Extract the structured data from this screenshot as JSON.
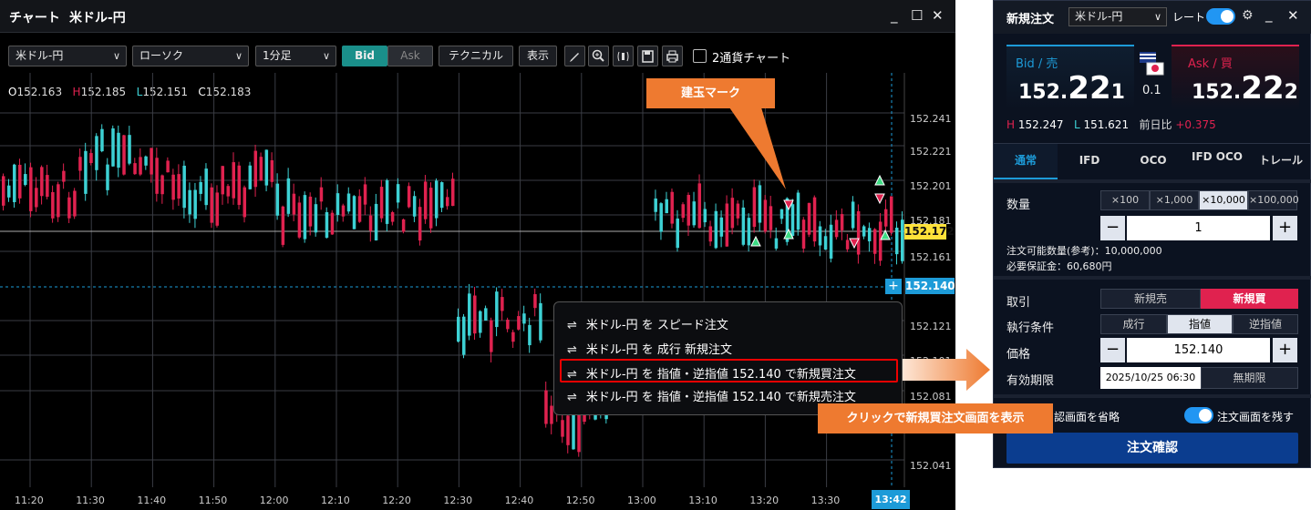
{
  "chart_window": {
    "title": "チャート",
    "symbol": "米ドル-円",
    "controls": {
      "min": "_",
      "max": "☐",
      "close": "✕"
    }
  },
  "toolbar": {
    "symbol_select": "米ドル-円",
    "chart_type_select": "ローソク",
    "interval_select": "1分足",
    "bid_label": "Bid",
    "ask_label": "Ask",
    "technical_label": "テクニカル",
    "display_label": "表示",
    "two_currency_label": "2通貨チャート",
    "icons": [
      "pencil-icon",
      "zoom-icon",
      "sound-icon",
      "save-icon",
      "print-icon"
    ]
  },
  "ohlc": {
    "o_key": "O",
    "o": "152.163",
    "h_key": "H",
    "h": "152.185",
    "l_key": "L",
    "l": "152.151",
    "c_key": "C",
    "c": "152.183"
  },
  "price_axis": [
    "152.241",
    "152.221",
    "152.201",
    "152.181",
    "152.161",
    "152.121",
    "152.101",
    "152.081",
    "152.041"
  ],
  "time_axis": [
    "11:20",
    "11:30",
    "11:40",
    "11:50",
    "12:00",
    "12:10",
    "12:20",
    "12:30",
    "12:40",
    "12:50",
    "13:00",
    "13:10",
    "13:20",
    "13:30"
  ],
  "current_price": "152.172",
  "bid_line_price": "152.140",
  "bid_line_plus": "+",
  "time_badge": "13:42",
  "context_menu": {
    "items": [
      "米ドル-円 を スピード注文",
      "米ドル-円 を 成行 新規注文",
      "米ドル-円 を 指値・逆指値 152.140 で新規買注文",
      "米ドル-円 を 指値・逆指値 152.140 で新規売注文"
    ],
    "icon": "⇌"
  },
  "callouts": {
    "position_mark": "建玉マーク",
    "click_hint": "クリックで新規買注文画面を表示"
  },
  "order_window": {
    "title": "新規注文",
    "symbol": "米ドル-円",
    "rate_label": "レート",
    "bid_label": "Bid / 売",
    "bid_big": "152.",
    "bid_pips": "22",
    "bid_small": "1",
    "ask_label": "Ask / 買",
    "ask_big": "152.",
    "ask_pips": "22",
    "ask_small": "2",
    "spread": "0.1",
    "high_key": "H",
    "high": "152.247",
    "low_key": "L",
    "low": "151.621",
    "change_label": "前日比",
    "change": "+0.375",
    "tabs": [
      "通常",
      "IFD",
      "OCO",
      "IFD OCO",
      "トレール"
    ],
    "quantity_label": "数量",
    "qty_steps": [
      "×100",
      "×1,000",
      "×10,000",
      "×100,000"
    ],
    "qty_minus": "−",
    "qty_plus": "+",
    "quantity": "1",
    "available": "注文可能数量(参考)：10,000,000",
    "margin": "必要保証金：60,680円",
    "trade_label": "取引",
    "trade_sell": "新規売",
    "trade_buy": "新規買",
    "condition_label": "執行条件",
    "conditions": [
      "成行",
      "指値",
      "逆指値"
    ],
    "price_label": "価格",
    "price": "152.140",
    "expiry_label": "有効期限",
    "expiry_date": "2025/10/25 06:30",
    "expiry_none": "無期限",
    "skip_confirm": "認画面を省略",
    "keep_screen": "注文画面を残す",
    "confirm_button": "注文確認"
  },
  "colors": {
    "up": "#3dd1d4",
    "down": "#e0224f",
    "accent": "#1d9bd8",
    "callout": "#ee7a30"
  }
}
